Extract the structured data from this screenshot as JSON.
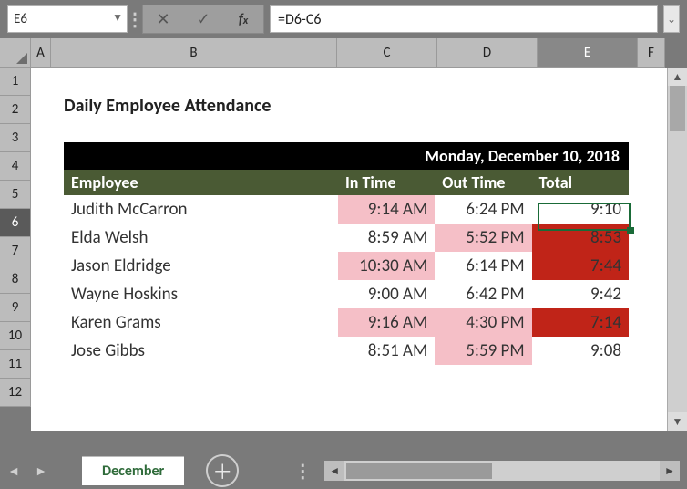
{
  "name_box": "E6",
  "formula": "=D6-C6",
  "columns": [
    "A",
    "B",
    "C",
    "D",
    "E",
    "F"
  ],
  "active_col": "E",
  "rows": [
    "1",
    "2",
    "3",
    "4",
    "5",
    "6",
    "7",
    "8",
    "9",
    "10",
    "11",
    "12"
  ],
  "active_row": "6",
  "title": "Daily Employee Attendance",
  "date_header": "Monday, December 10, 2018",
  "headers": {
    "employee": "Employee",
    "in": "In Time",
    "out": "Out Time",
    "total": "Total"
  },
  "data": [
    {
      "employee": "Judith McCarron",
      "in": "9:14 AM",
      "out": "6:24 PM",
      "total": "9:10",
      "in_flag": "pink",
      "out_flag": "",
      "total_flag": ""
    },
    {
      "employee": "Elda Welsh",
      "in": "8:59 AM",
      "out": "5:52 PM",
      "total": "8:53",
      "in_flag": "",
      "out_flag": "pink",
      "total_flag": "red"
    },
    {
      "employee": "Jason Eldridge",
      "in": "10:30 AM",
      "out": "6:14 PM",
      "total": "7:44",
      "in_flag": "pink",
      "out_flag": "",
      "total_flag": "red"
    },
    {
      "employee": "Wayne Hoskins",
      "in": "9:00 AM",
      "out": "6:42 PM",
      "total": "9:42",
      "in_flag": "",
      "out_flag": "",
      "total_flag": ""
    },
    {
      "employee": "Karen Grams",
      "in": "9:16 AM",
      "out": "4:30 PM",
      "total": "7:14",
      "in_flag": "pink",
      "out_flag": "pink",
      "total_flag": "red"
    },
    {
      "employee": "Jose Gibbs",
      "in": "8:51 AM",
      "out": "5:59 PM",
      "total": "9:08",
      "in_flag": "",
      "out_flag": "pink",
      "total_flag": ""
    }
  ],
  "tab": "December",
  "chart_data": {
    "type": "table",
    "title": "Daily Employee Attendance — Monday, December 10, 2018",
    "columns": [
      "Employee",
      "In Time",
      "Out Time",
      "Total"
    ],
    "rows": [
      [
        "Judith McCarron",
        "9:14 AM",
        "6:24 PM",
        "9:10"
      ],
      [
        "Elda Welsh",
        "8:59 AM",
        "5:52 PM",
        "8:53"
      ],
      [
        "Jason Eldridge",
        "10:30 AM",
        "6:14 PM",
        "7:44"
      ],
      [
        "Wayne Hoskins",
        "9:00 AM",
        "6:42 PM",
        "9:42"
      ],
      [
        "Karen Grams",
        "9:16 AM",
        "4:30 PM",
        "7:14"
      ],
      [
        "Jose Gibbs",
        "8:51 AM",
        "5:59 PM",
        "9:08"
      ]
    ]
  }
}
